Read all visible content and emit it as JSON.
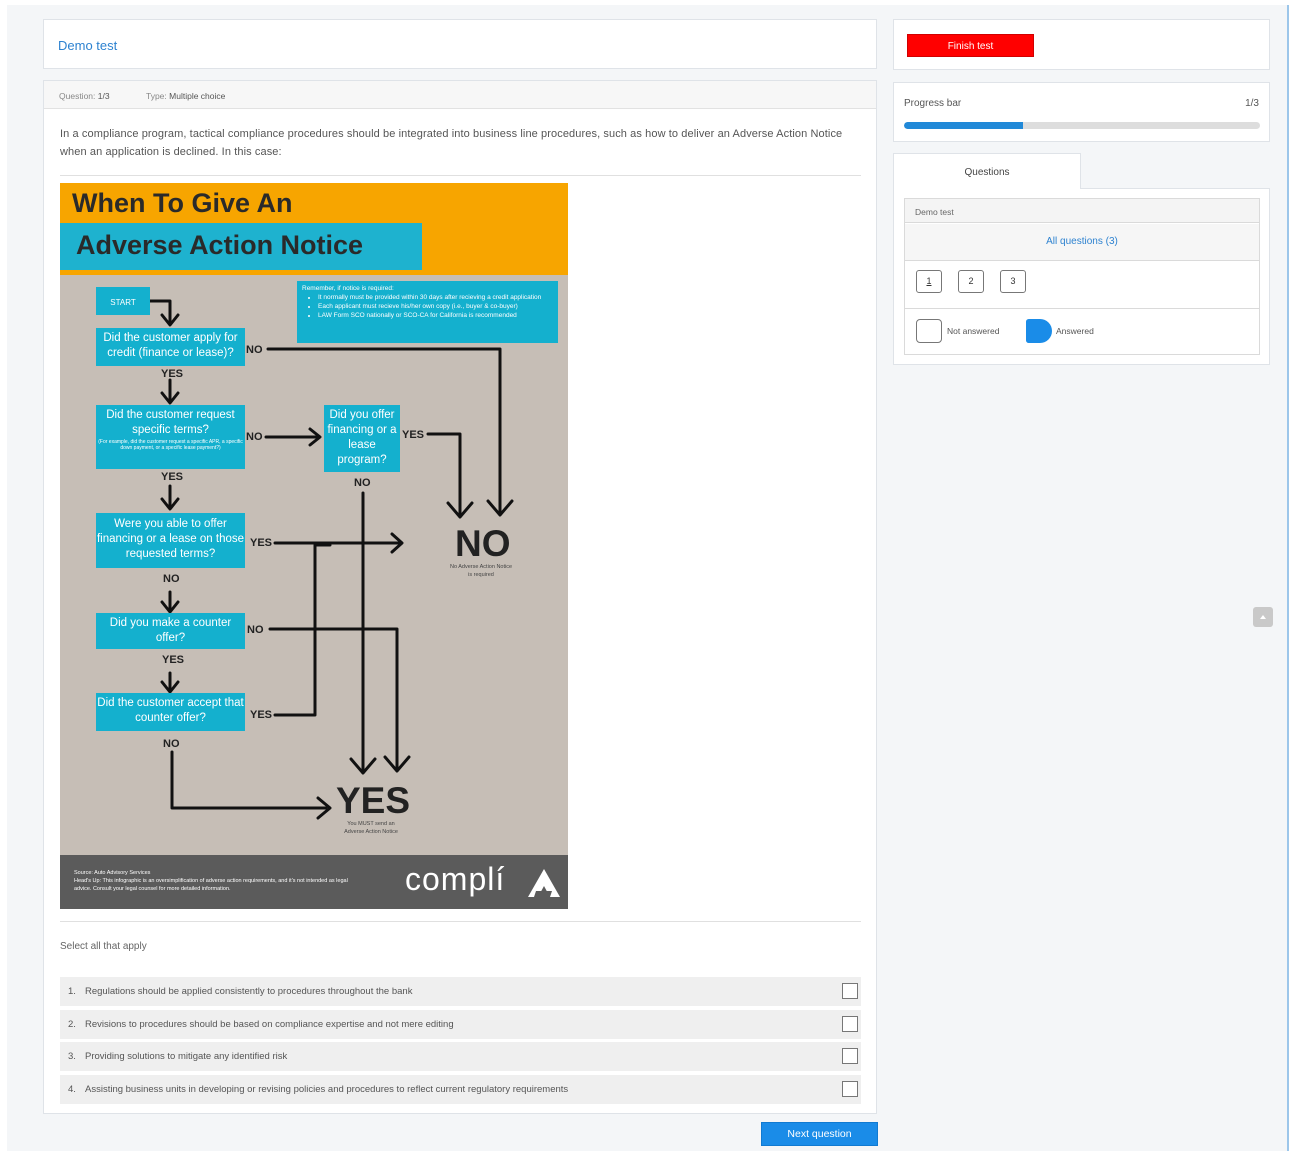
{
  "test": {
    "title": "Demo test"
  },
  "question": {
    "number_label": "Question:",
    "number_value": "1/3",
    "type_label": "Type:",
    "type_value": "Multiple choice",
    "text": "In a compliance program, tactical compliance procedures should be integrated into business line procedures, such as how to deliver an Adverse Action Notice when an application is declined. In this case:",
    "instruction": "Select all that apply",
    "options": [
      {
        "num": "1.",
        "text": "Regulations should be applied consistently to procedures throughout the bank"
      },
      {
        "num": "2.",
        "text": "Revisions to procedures should be based on compliance expertise and not mere editing"
      },
      {
        "num": "3.",
        "text": "Providing solutions to mitigate any identified risk"
      },
      {
        "num": "4.",
        "text": "Assisting business units in developing or revising policies and procedures to reflect current regulatory requirements"
      }
    ]
  },
  "infographic": {
    "title_line1": "When To Give An",
    "title_line2": "Adverse Action Notice",
    "start": "START",
    "q1": "Did the customer apply for credit (finance or lease)?",
    "q2": "Did the customer request specific terms?",
    "q2_note": "(For example, did the customer request a specific APR, a specific down payment, or a specific lease payment?)",
    "q3": "Did you offer financing or a lease program?",
    "q4": "Were you able to offer financing or a lease on those requested terms?",
    "q5": "Did you make a counter offer?",
    "q6": "Did the customer accept that counter offer?",
    "yes": "YES",
    "no": "NO",
    "remember_title": "Remember, if notice is required:",
    "remember_items": [
      "It normally must be provided within 30 days after recieving a credit application",
      "Each applicant must recieve his/her own copy (i.e., buyer & co-buyer)",
      "LAW Form SCO nationally or SCO-CA for California is recommended"
    ],
    "big_no": "NO",
    "big_no_note": "No Adverse Action Notice is required",
    "big_yes": "YES",
    "big_yes_note": "You MUST send an Adverse Action Notice",
    "source": "Source: Auto Advisory Services",
    "disclaimer": "Head's Up: This infographic is an oversimplification of adverse action requirements, and it's not intended as legal advice. Consult your legal counsel for more detailed information.",
    "logo": "complí"
  },
  "buttons": {
    "finish": "Finish test",
    "next": "Next question"
  },
  "progress": {
    "label": "Progress bar",
    "count": "1/3",
    "fraction": 0.333
  },
  "questions_panel": {
    "tab": "Questions",
    "section": "Demo test",
    "all_questions": "All questions (3)",
    "numbers": [
      "1",
      "2",
      "3"
    ],
    "legend_not_answered": "Not answered",
    "legend_answered": "Answered"
  },
  "icons": {
    "scroll_top": "chevron-up-icon",
    "checkbox": "checkbox-icon"
  },
  "colors": {
    "accent": "#1a8ce8",
    "finish": "#ff0000",
    "link": "#2d82d0",
    "banner": "#f7a500",
    "flow_box": "#14b0ce"
  }
}
